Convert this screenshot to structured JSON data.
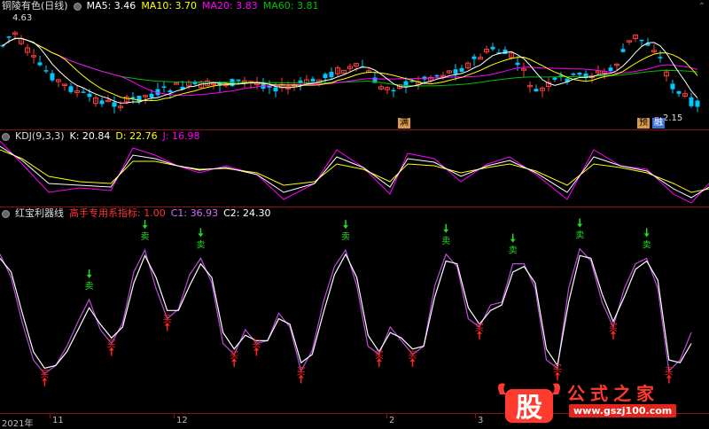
{
  "price_panel": {
    "title": "铜陵有色(日线)",
    "ma5_label": "MA5: 3.46",
    "ma10_label": "MA10: 3.70",
    "ma20_label": "MA20: 3.83",
    "ma60_label": "MA60: 3.81",
    "high_label": "4.63",
    "low_label": "2.15",
    "event_tag_1": "满",
    "event_tag_2": "预",
    "event_tag_3": "融"
  },
  "kdj_panel": {
    "title": "KDJ(9,3,3)",
    "k_label": "K: 20.84",
    "d_label": "D: 22.76",
    "j_label": "J: 16.98"
  },
  "signal_panel": {
    "title": "红宝利器线",
    "indicator_label": "高手专用系指标: 1.00",
    "c1_label": "C1: 36.93",
    "c2_label": "C2: 24.30",
    "buy_text": "买",
    "sell_text": "卖"
  },
  "time_axis": {
    "ticks": [
      "2021年",
      "11",
      "12",
      "2",
      "3"
    ]
  },
  "watermark": {
    "logo_char": "股",
    "site_name": "公式之家",
    "url": "www.gszj100.com"
  },
  "colors": {
    "up": "#ff3b3b",
    "down": "#00c8ff",
    "ma5": "#ffffff",
    "ma10": "#ffff00",
    "ma20": "#ff00ff",
    "ma60": "#00c000",
    "signal_main": "#b84fd8",
    "signal_fast": "#ffffff",
    "buy": "#ff2020",
    "sell": "#22dd22"
  },
  "chart_data": {
    "type": "line",
    "series": [
      {
        "name": "C1",
        "values": [
          95,
          78,
          45,
          18,
          8,
          14,
          28,
          46,
          62,
          40,
          30,
          45,
          82,
          98,
          70,
          48,
          55,
          80,
          92,
          74,
          30,
          22,
          40,
          30,
          32,
          52,
          42,
          10,
          25,
          60,
          86,
          98,
          72,
          28,
          22,
          42,
          32,
          22,
          28,
          72,
          95,
          86,
          48,
          42,
          58,
          60,
          88,
          88,
          70,
          18,
          12,
          70,
          99,
          90,
          60,
          42,
          70,
          88,
          92,
          70,
          10,
          18,
          38
        ]
      },
      {
        "name": "C2",
        "values": [
          92,
          82,
          52,
          24,
          12,
          14,
          24,
          40,
          56,
          44,
          34,
          42,
          74,
          94,
          78,
          54,
          54,
          72,
          88,
          78,
          38,
          26,
          36,
          32,
          32,
          48,
          44,
          16,
          22,
          52,
          80,
          95,
          78,
          36,
          24,
          38,
          34,
          26,
          28,
          64,
          90,
          88,
          56,
          44,
          54,
          58,
          82,
          86,
          74,
          26,
          14,
          60,
          94,
          92,
          66,
          46,
          64,
          84,
          90,
          76,
          18,
          16,
          30
        ]
      }
    ],
    "ylim": [
      0,
      100
    ]
  }
}
